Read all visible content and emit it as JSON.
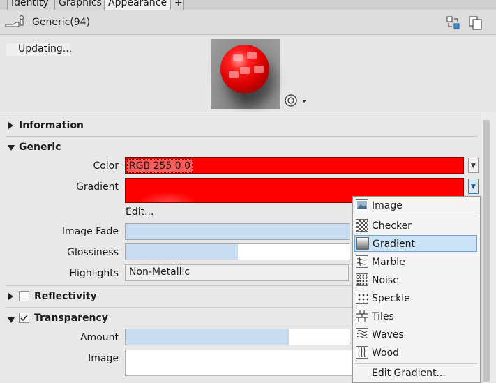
{
  "tabs": [
    {
      "label": "Identity"
    },
    {
      "label": "Graphics"
    },
    {
      "label": "Appearance"
    },
    {
      "label": "+"
    }
  ],
  "header": {
    "title": "Generic(94)",
    "status": "Updating..."
  },
  "sections": {
    "information": "Information",
    "generic": "Generic",
    "reflectivity": "Reflectivity",
    "transparency": "Transparency"
  },
  "generic": {
    "color_label": "Color",
    "color_value": "RGB 255 0 0",
    "gradient_label": "Gradient",
    "edit_link": "Edit...",
    "image_fade_label": "Image Fade",
    "image_fade_level": 1.0,
    "glossiness_label": "Glossiness",
    "glossiness_level": 0.5,
    "highlights_label": "Highlights",
    "highlights_value": "Non-Metallic"
  },
  "transparency": {
    "checked": true,
    "amount_label": "Amount",
    "amount_level": 0.73,
    "image_label": "Image"
  },
  "reflectivity": {
    "checked": false
  },
  "colors": {
    "accent_red": "#ff0000",
    "selection": "#cce4f7",
    "fill": "#c8ddf2"
  },
  "menu": {
    "items": [
      {
        "label": "Image",
        "icon": "image-icon"
      },
      {
        "label": "Checker",
        "icon": "checker-icon"
      },
      {
        "label": "Gradient",
        "icon": "gradient-icon",
        "selected": true
      },
      {
        "label": "Marble",
        "icon": "marble-icon"
      },
      {
        "label": "Noise",
        "icon": "noise-icon"
      },
      {
        "label": "Speckle",
        "icon": "speckle-icon"
      },
      {
        "label": "Tiles",
        "icon": "tiles-icon"
      },
      {
        "label": "Waves",
        "icon": "waves-icon"
      },
      {
        "label": "Wood",
        "icon": "wood-icon"
      }
    ],
    "edit_label": "Edit Gradient..."
  }
}
